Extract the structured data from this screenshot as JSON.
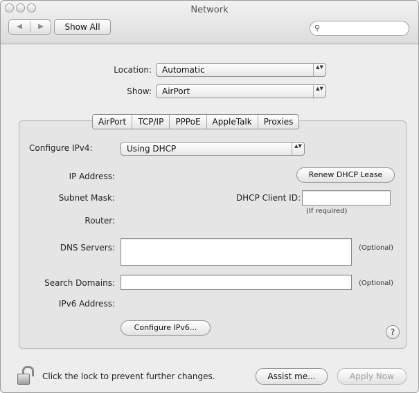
{
  "window": {
    "title": "Network"
  },
  "toolbar": {
    "back_glyph": "◀",
    "forward_glyph": "▶",
    "show_all_label": "Show All",
    "search_value": "",
    "search_glyph": "⚲"
  },
  "location": {
    "label": "Location:",
    "value": "Automatic"
  },
  "show": {
    "label": "Show:",
    "value": "AirPort"
  },
  "tabs": [
    {
      "label": "AirPort"
    },
    {
      "label": "TCP/IP"
    },
    {
      "label": "PPPoE"
    },
    {
      "label": "AppleTalk"
    },
    {
      "label": "Proxies"
    }
  ],
  "tcpip": {
    "configure_label": "Configure IPv4:",
    "configure_value": "Using DHCP",
    "ip_address_label": "IP Address:",
    "renew_label": "Renew DHCP Lease",
    "subnet_mask_label": "Subnet Mask:",
    "dhcp_client_id_label": "DHCP Client ID:",
    "dhcp_client_id_value": "",
    "if_required_note": "(If required)",
    "router_label": "Router:",
    "dns_servers_label": "DNS Servers:",
    "dns_servers_value": "",
    "optional_note": "(Optional)",
    "search_domains_label": "Search Domains:",
    "search_domains_value": "",
    "ipv6_address_label": "IPv6 Address:",
    "configure_ipv6_label": "Configure IPv6...",
    "help_glyph": "?"
  },
  "footer": {
    "lock_message": "Click the lock to prevent further changes.",
    "assist_label": "Assist me...",
    "apply_label": "Apply Now"
  },
  "popup_arrows": "▲▼"
}
